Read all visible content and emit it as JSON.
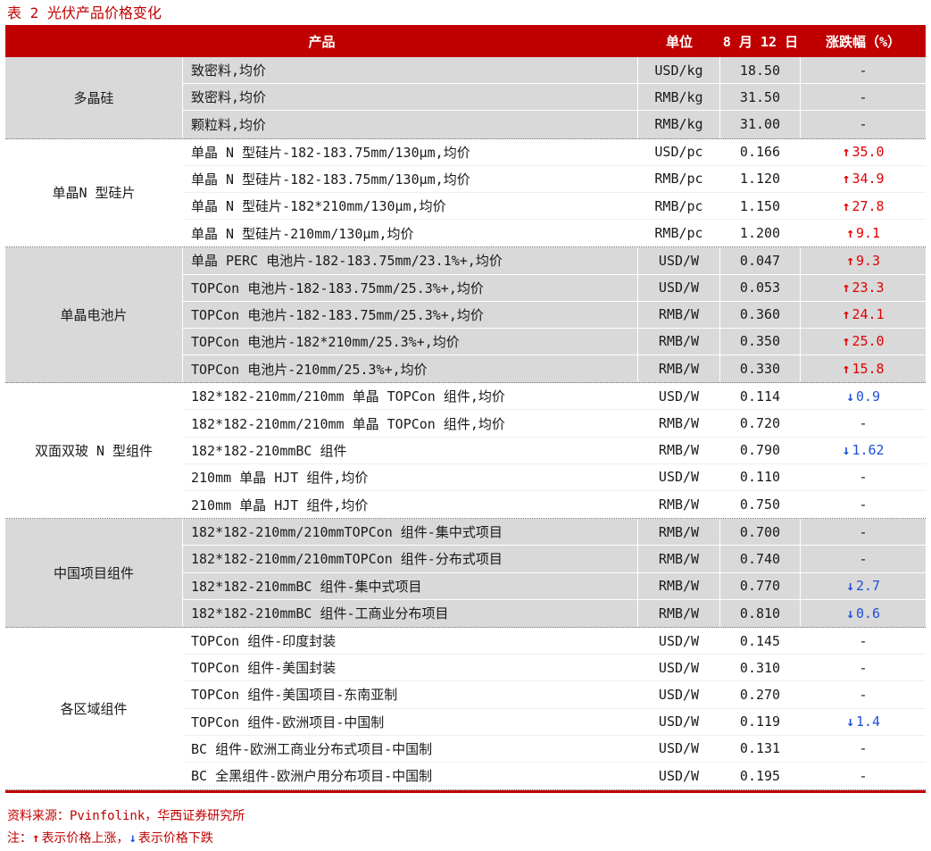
{
  "title": "表 2 光伏产品价格变化",
  "header": {
    "product": "产品",
    "unit": "单位",
    "date": "8 月 12 日",
    "change": "涨跌幅（%）"
  },
  "groups": [
    {
      "name": "多晶硅",
      "shade": true,
      "rows": [
        {
          "product": "致密料,均价",
          "unit": "USD/kg",
          "price": "18.50",
          "dir": "",
          "change": "-"
        },
        {
          "product": "致密料,均价",
          "unit": "RMB/kg",
          "price": "31.50",
          "dir": "",
          "change": "-"
        },
        {
          "product": "颗粒料,均价",
          "unit": "RMB/kg",
          "price": "31.00",
          "dir": "",
          "change": "-"
        }
      ]
    },
    {
      "name": "单晶N 型硅片",
      "shade": false,
      "rows": [
        {
          "product": "单晶 N 型硅片-182-183.75mm/130μm,均价",
          "unit": "USD/pc",
          "price": "0.166",
          "dir": "up",
          "change": "35.0"
        },
        {
          "product": "单晶 N 型硅片-182-183.75mm/130μm,均价",
          "unit": "RMB/pc",
          "price": "1.120",
          "dir": "up",
          "change": "34.9"
        },
        {
          "product": "单晶 N 型硅片-182*210mm/130μm,均价",
          "unit": "RMB/pc",
          "price": "1.150",
          "dir": "up",
          "change": "27.8"
        },
        {
          "product": "单晶 N 型硅片-210mm/130μm,均价",
          "unit": "RMB/pc",
          "price": "1.200",
          "dir": "up",
          "change": "9.1"
        }
      ]
    },
    {
      "name": "单晶电池片",
      "shade": true,
      "rows": [
        {
          "product": "单晶 PERC 电池片-182-183.75mm/23.1%+,均价",
          "unit": "USD/W",
          "price": "0.047",
          "dir": "up",
          "change": "9.3"
        },
        {
          "product": "TOPCon 电池片-182-183.75mm/25.3%+,均价",
          "unit": "USD/W",
          "price": "0.053",
          "dir": "up",
          "change": "23.3"
        },
        {
          "product": "TOPCon 电池片-182-183.75mm/25.3%+,均价",
          "unit": "RMB/W",
          "price": "0.360",
          "dir": "up",
          "change": "24.1"
        },
        {
          "product": "TOPCon 电池片-182*210mm/25.3%+,均价",
          "unit": "RMB/W",
          "price": "0.350",
          "dir": "up",
          "change": "25.0"
        },
        {
          "product": "TOPCon 电池片-210mm/25.3%+,均价",
          "unit": "RMB/W",
          "price": "0.330",
          "dir": "up",
          "change": "15.8"
        }
      ]
    },
    {
      "name": "双面双玻 N 型组件",
      "shade": false,
      "rows": [
        {
          "product": "182*182-210mm/210mm 单晶 TOPCon 组件,均价",
          "unit": "USD/W",
          "price": "0.114",
          "dir": "down",
          "change": "0.9"
        },
        {
          "product": "182*182-210mm/210mm 单晶 TOPCon 组件,均价",
          "unit": "RMB/W",
          "price": "0.720",
          "dir": "",
          "change": "-"
        },
        {
          "product": "182*182-210mmBC 组件",
          "unit": "RMB/W",
          "price": "0.790",
          "dir": "down",
          "change": "1.62"
        },
        {
          "product": "210mm 单晶 HJT 组件,均价",
          "unit": "USD/W",
          "price": "0.110",
          "dir": "",
          "change": "-"
        },
        {
          "product": "210mm 单晶 HJT 组件,均价",
          "unit": "RMB/W",
          "price": "0.750",
          "dir": "",
          "change": "-"
        }
      ]
    },
    {
      "name": "中国项目组件",
      "shade": true,
      "rows": [
        {
          "product": "182*182-210mm/210mmTOPCon 组件-集中式项目",
          "unit": "RMB/W",
          "price": "0.700",
          "dir": "",
          "change": "-"
        },
        {
          "product": "182*182-210mm/210mmTOPCon 组件-分布式项目",
          "unit": "RMB/W",
          "price": "0.740",
          "dir": "",
          "change": "-"
        },
        {
          "product": "182*182-210mmBC 组件-集中式项目",
          "unit": "RMB/W",
          "price": "0.770",
          "dir": "down",
          "change": "2.7"
        },
        {
          "product": "182*182-210mmBC 组件-工商业分布项目",
          "unit": "RMB/W",
          "price": "0.810",
          "dir": "down",
          "change": "0.6"
        }
      ]
    },
    {
      "name": "各区域组件",
      "shade": false,
      "rows": [
        {
          "product": "TOPCon 组件-印度封装",
          "unit": "USD/W",
          "price": "0.145",
          "dir": "",
          "change": "-"
        },
        {
          "product": "TOPCon 组件-美国封装",
          "unit": "USD/W",
          "price": "0.310",
          "dir": "",
          "change": "-"
        },
        {
          "product": "TOPCon 组件-美国项目-东南亚制",
          "unit": "USD/W",
          "price": "0.270",
          "dir": "",
          "change": "-"
        },
        {
          "product": "TOPCon 组件-欧洲项目-中国制",
          "unit": "USD/W",
          "price": "0.119",
          "dir": "down",
          "change": "1.4"
        },
        {
          "product": "BC 组件-欧洲工商业分布式项目-中国制",
          "unit": "USD/W",
          "price": "0.131",
          "dir": "",
          "change": "-"
        },
        {
          "product": "BC 全黑组件-欧洲户用分布项目-中国制",
          "unit": "USD/W",
          "price": "0.195",
          "dir": "",
          "change": "-"
        }
      ]
    }
  ],
  "footer": {
    "source": "资料来源：Pvinfolink，华西证券研究所",
    "note_prefix": "注：",
    "note_up": "表示价格上涨，",
    "note_down": "表示价格下跌"
  },
  "colors": {
    "accent": "#c00000",
    "up": "#e00000",
    "down": "#1f4fd8",
    "shade": "#d9d9d9"
  },
  "icons": {
    "up": "arrow-up-icon",
    "down": "arrow-down-icon"
  }
}
